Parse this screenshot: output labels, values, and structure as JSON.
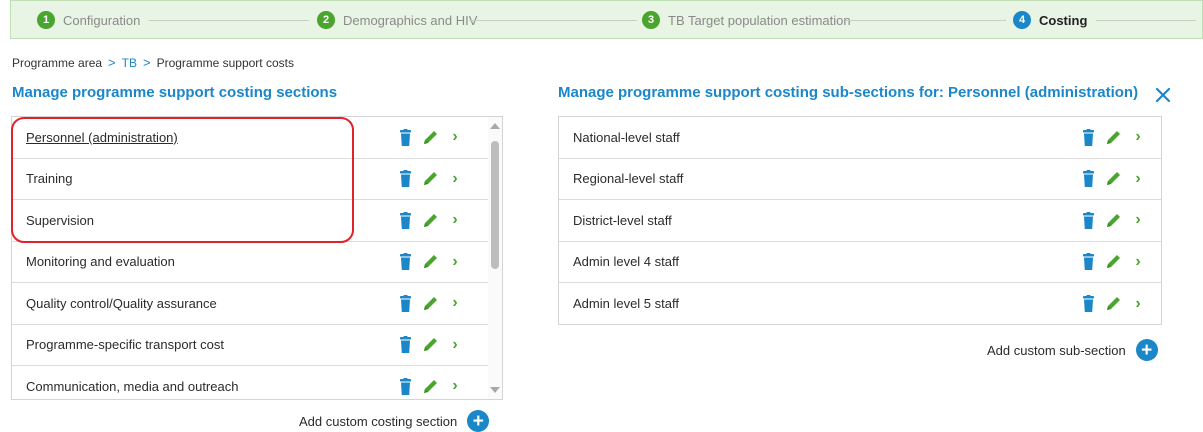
{
  "stepper": {
    "steps": [
      {
        "num": "1",
        "label": "Configuration",
        "state": "done"
      },
      {
        "num": "2",
        "label": "Demographics and HIV",
        "state": "done"
      },
      {
        "num": "3",
        "label": "TB Target population estimation",
        "state": "done"
      },
      {
        "num": "4",
        "label": "Costing",
        "state": "active"
      }
    ]
  },
  "breadcrumb": {
    "items": [
      "Programme area",
      "TB",
      "Programme support costs"
    ],
    "separator": ">"
  },
  "left_panel": {
    "title": "Manage programme support costing sections",
    "rows": [
      {
        "label": "Personnel (administration)",
        "selected": true
      },
      {
        "label": "Training"
      },
      {
        "label": "Supervision"
      },
      {
        "label": "Monitoring and evaluation"
      },
      {
        "label": "Quality control/Quality assurance"
      },
      {
        "label": "Programme-specific transport cost"
      },
      {
        "label": "Communication, media and outreach"
      }
    ],
    "add_label": "Add custom costing section"
  },
  "right_panel": {
    "title": "Manage programme support costing sub-sections for: Personnel (administration)",
    "rows": [
      {
        "label": "National-level staff"
      },
      {
        "label": "Regional-level staff"
      },
      {
        "label": "District-level staff"
      },
      {
        "label": "Admin level 4 staff"
      },
      {
        "label": "Admin level 5 staff"
      }
    ],
    "add_label": "Add custom sub-section"
  },
  "icons": {
    "delete": "trash-icon",
    "edit": "pencil-icon",
    "open": "chevron-right-icon",
    "add": "plus-circle-icon",
    "close": "close-icon"
  },
  "colors": {
    "accent": "#1b87c9",
    "success": "#4aa52e",
    "highlight": "#e2222a",
    "stepper_bg": "#e8f4e4"
  }
}
